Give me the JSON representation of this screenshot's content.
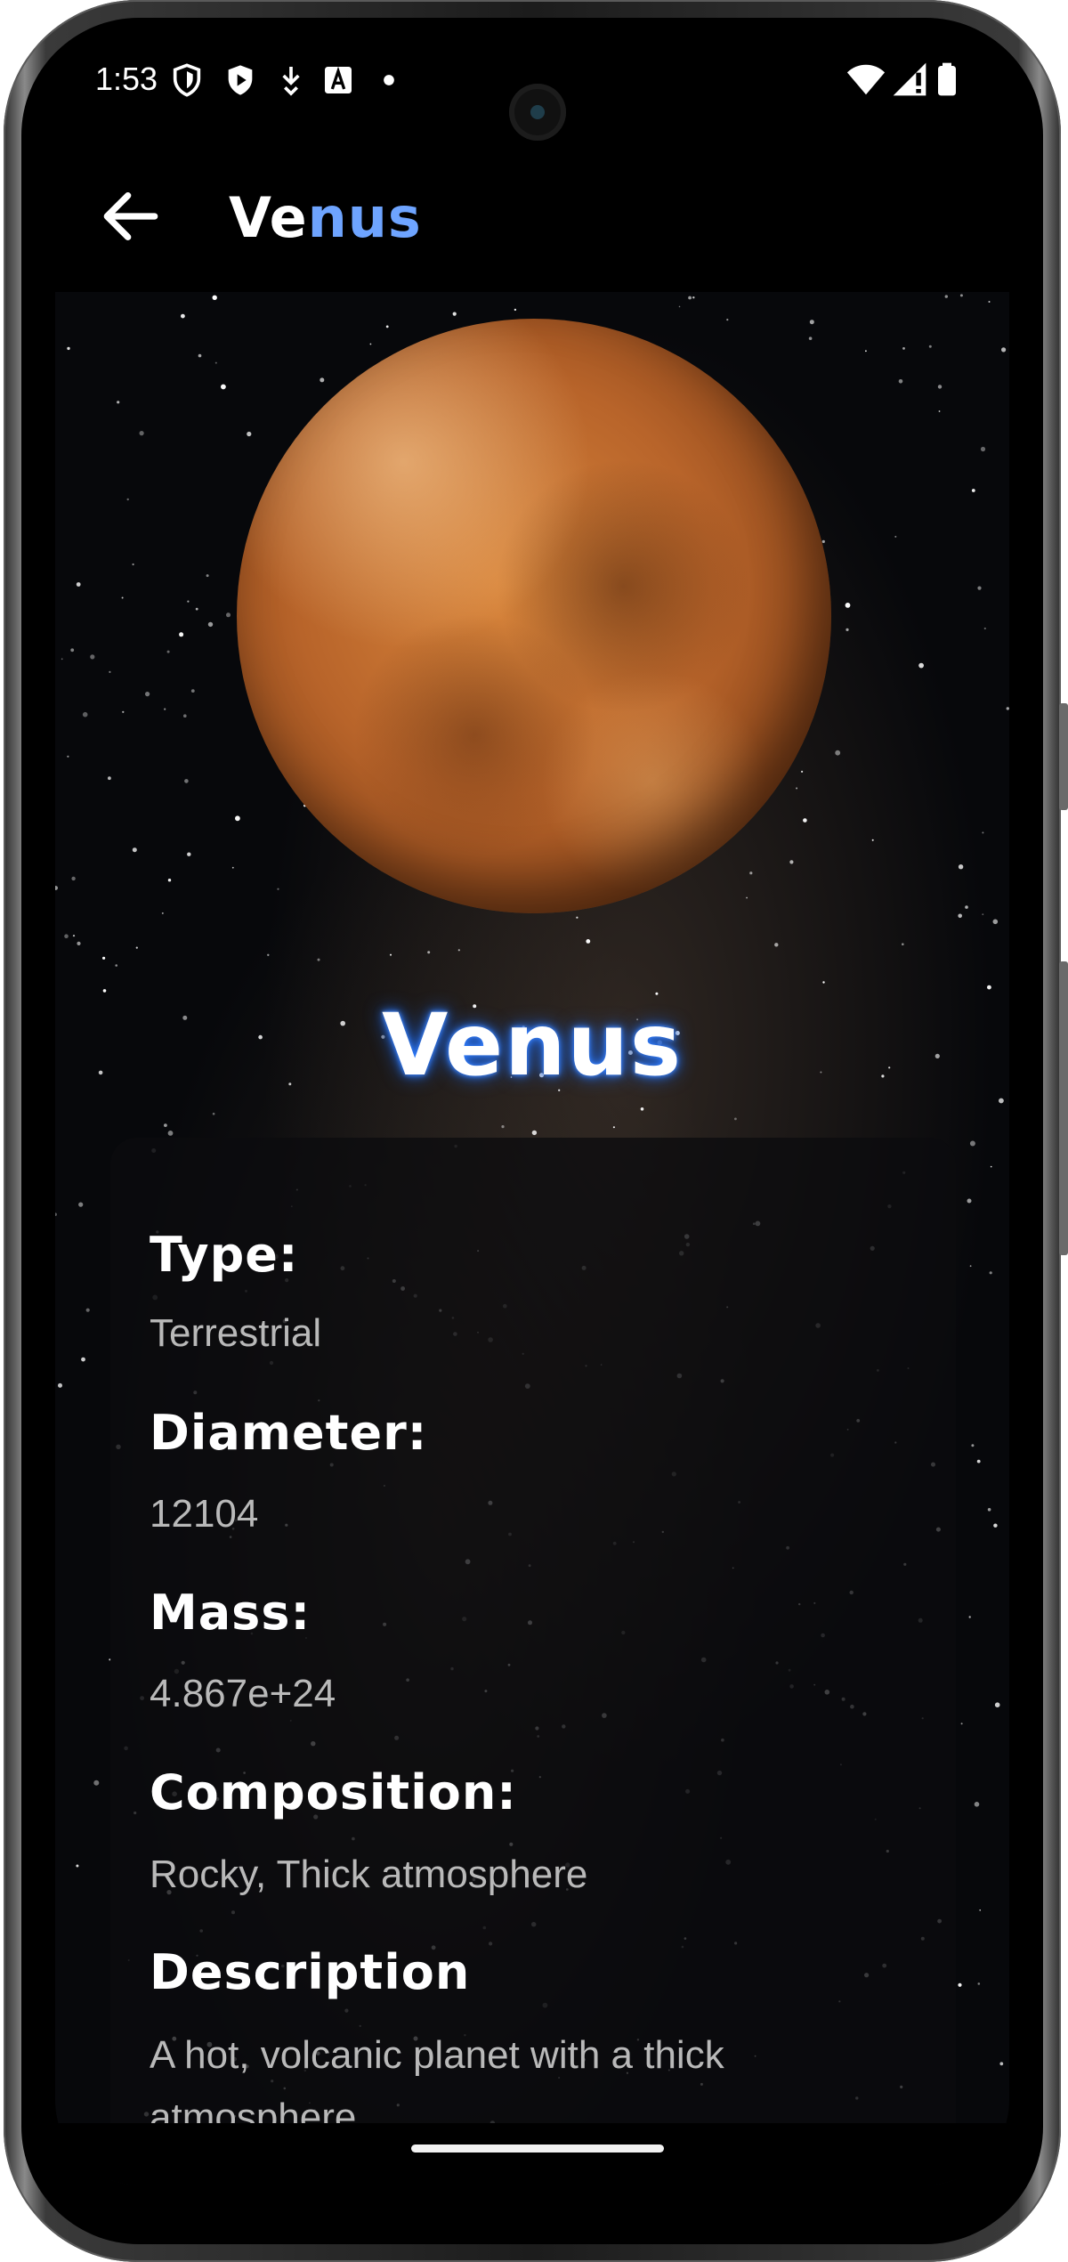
{
  "status_bar": {
    "time": "1:53",
    "left_icons": [
      "shield-icon",
      "play-protect-icon",
      "download-icon",
      "font-app-icon",
      "dot-icon"
    ],
    "right_icons": [
      "wifi-icon",
      "signal-icon",
      "battery-icon"
    ]
  },
  "app_bar": {
    "title_part1": "Ve",
    "title_part2": "nus",
    "back_icon": "arrow-back-icon",
    "accent_color": "#6ea4ff"
  },
  "planet": {
    "name": "Venus",
    "fields": [
      {
        "label": "Type:",
        "value": "Terrestrial"
      },
      {
        "label": "Diameter:",
        "value": "12104"
      },
      {
        "label": "Mass:",
        "value": "4.867e+24"
      },
      {
        "label": "Composition:",
        "value": "Rocky, Thick atmosphere"
      },
      {
        "label": "Description",
        "value": "A hot, volcanic planet with a thick atmosphere."
      }
    ]
  }
}
